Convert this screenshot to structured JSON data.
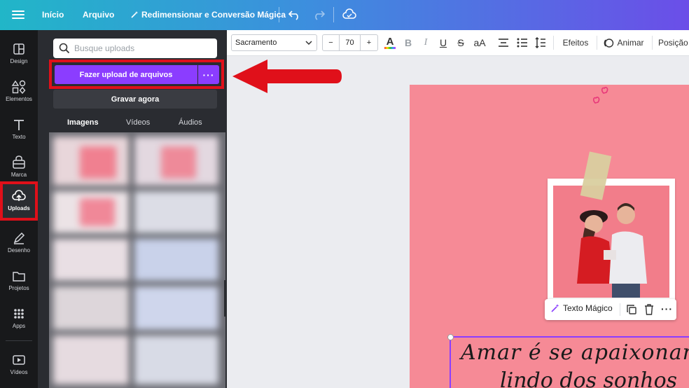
{
  "topbar": {
    "home": "Início",
    "file": "Arquivo",
    "resize": "Redimensionar e Conversão Mágica"
  },
  "rail": [
    {
      "label": "Design",
      "icon": "layout-icon"
    },
    {
      "label": "Elementos",
      "icon": "shapes-icon"
    },
    {
      "label": "Texto",
      "icon": "text-icon"
    },
    {
      "label": "Marca",
      "icon": "brand-icon"
    },
    {
      "label": "Uploads",
      "icon": "cloud-upload-icon"
    },
    {
      "label": "Desenho",
      "icon": "pen-icon"
    },
    {
      "label": "Projetos",
      "icon": "folder-icon"
    },
    {
      "label": "Apps",
      "icon": "apps-grid-icon"
    },
    {
      "label": "Vídeos",
      "icon": "video-icon"
    }
  ],
  "panel": {
    "search_placeholder": "Busque uploads",
    "upload_button": "Fazer upload de arquivos",
    "more_button": "···",
    "record_button": "Gravar agora",
    "tabs": [
      "Imagens",
      "Vídeos",
      "Áudios"
    ]
  },
  "toolbar": {
    "font": "Sacramento",
    "minus": "−",
    "size": "70",
    "plus": "+",
    "color_letter": "A",
    "bold": "B",
    "italic": "I",
    "underline": "U",
    "strike": "S",
    "case": "aA",
    "effects": "Efeitos",
    "animate": "Animar",
    "position": "Posição"
  },
  "canvas": {
    "ctx_magic": "Texto Mágico",
    "ctx_more": "···",
    "text_line1": "Amar é se apaixonar",
    "text_line2": "lindo dos sonhos"
  },
  "colors": {
    "accent": "#8b3dff",
    "highlight_red": "#e0101a",
    "page_pink": "#f68a96"
  }
}
